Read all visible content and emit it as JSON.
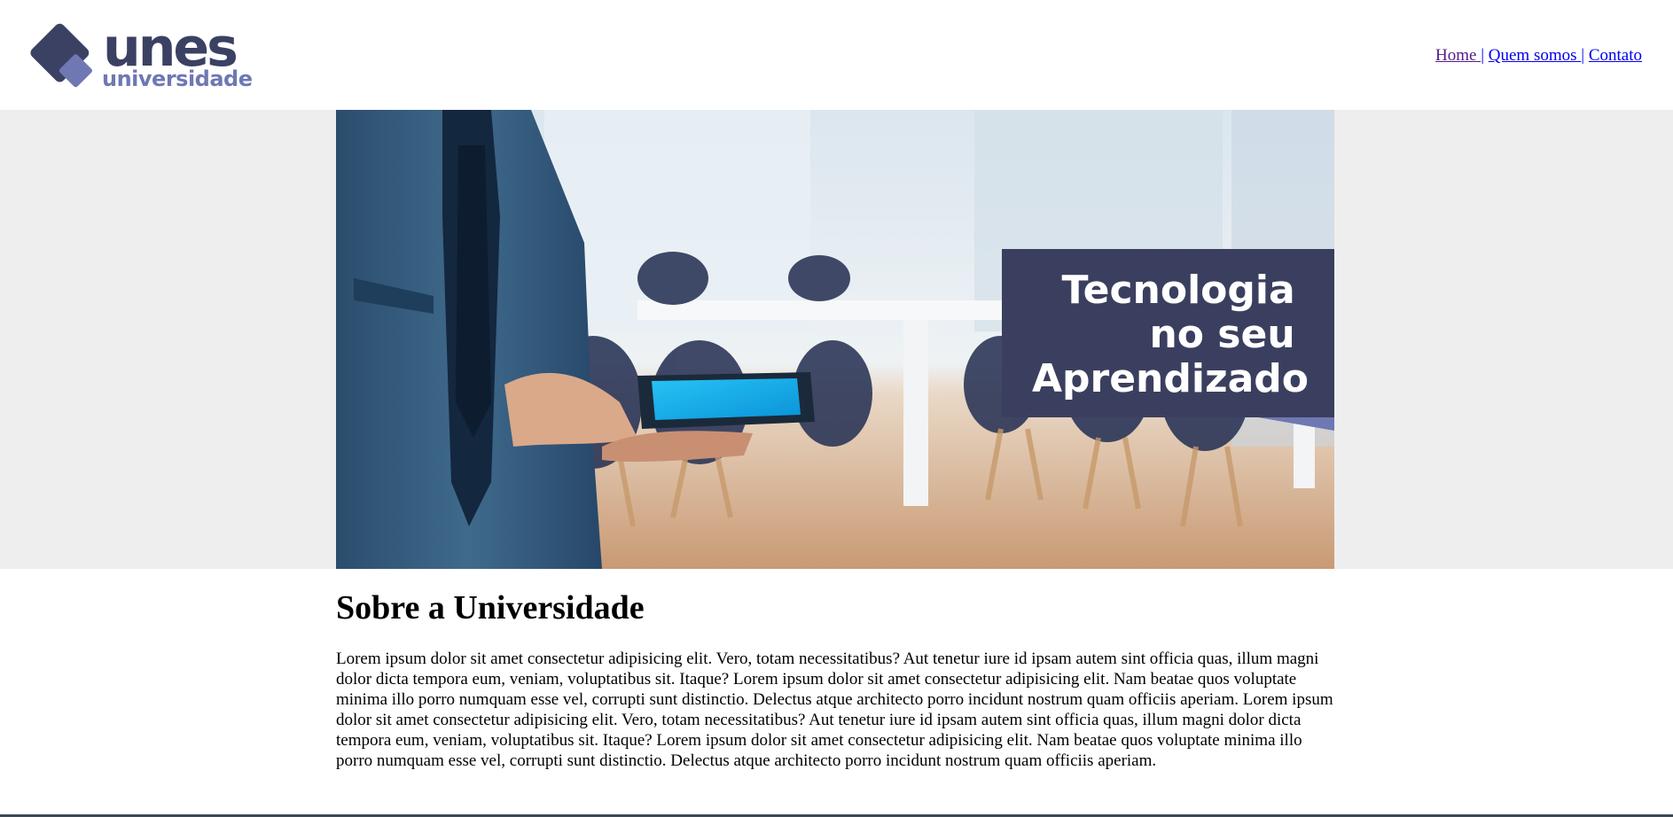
{
  "header": {
    "logo": {
      "word": "unes",
      "sub": "universidade",
      "colors": {
        "dark": "#3b4163",
        "light": "#6f78b3"
      }
    },
    "nav": [
      {
        "label": "Home ",
        "state": "visited"
      },
      {
        "label": "Quem somos ",
        "state": "link"
      },
      {
        "label": "Contato",
        "state": "link"
      }
    ],
    "separator": "|"
  },
  "hero": {
    "headline_lines": [
      "Tecnologia",
      "no seu",
      "Aprendizado"
    ],
    "overlay_color": "#3b3f5f",
    "background_color": "#eeeeee"
  },
  "main": {
    "title": "Sobre a Universidade",
    "paragraph": "Lorem ipsum dolor sit amet consectetur adipisicing elit. Vero, totam necessitatibus? Aut tenetur iure id ipsam autem sint officia quas, illum magni dolor dicta tempora eum, veniam, voluptatibus sit. Itaque? Lorem ipsum dolor sit amet consectetur adipisicing elit. Nam beatae quos voluptate minima illo porro numquam esse vel, corrupti sunt distinctio. Delectus atque architecto porro incidunt nostrum quam officiis aperiam. Lorem ipsum dolor sit amet consectetur adipisicing elit. Vero, totam necessitatibus? Aut tenetur iure id ipsam autem sint officia quas, illum magni dolor dicta tempora eum, veniam, voluptatibus sit. Itaque? Lorem ipsum dolor sit amet consectetur adipisicing elit. Nam beatae quos voluptate minima illo porro numquam esse vel, corrupti sunt distinctio. Delectus atque architecto porro incidunt nostrum quam officiis aperiam."
  }
}
